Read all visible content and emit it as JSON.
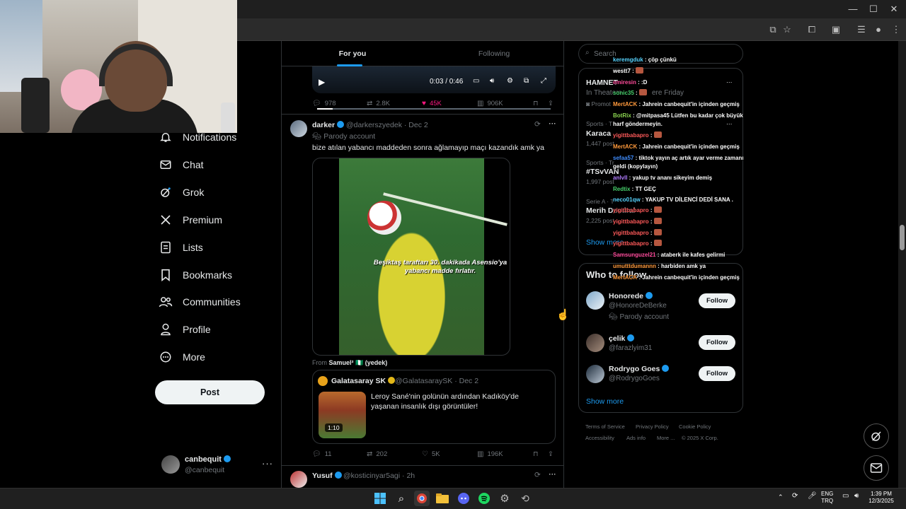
{
  "browser": {
    "controls": {
      "minimize": "—",
      "maximize": "☐",
      "close": "✕"
    }
  },
  "nav": {
    "items": [
      {
        "label": "Notifications",
        "icon": "bell-icon"
      },
      {
        "label": "Chat",
        "icon": "envelope-icon"
      },
      {
        "label": "Grok",
        "icon": "grok-icon"
      },
      {
        "label": "Premium",
        "icon": "x-logo-icon"
      },
      {
        "label": "Lists",
        "icon": "list-icon"
      },
      {
        "label": "Bookmarks",
        "icon": "bookmark-icon"
      },
      {
        "label": "Communities",
        "icon": "communities-icon"
      },
      {
        "label": "Profile",
        "icon": "person-icon"
      },
      {
        "label": "More",
        "icon": "more-circle-icon"
      }
    ],
    "post_label": "Post",
    "account": {
      "name": "canbequit",
      "handle": "@canbequit",
      "menu": "···"
    }
  },
  "timeline": {
    "tabs": [
      "For you",
      "Following"
    ],
    "video": {
      "time": "0:03 / 0:46"
    },
    "prev_actions": {
      "replies": "978",
      "reposts": "2.8K",
      "likes": "45K",
      "views": "906K"
    },
    "tweet1": {
      "name": "darker",
      "handle": "@darkerszyedek",
      "date": "· Dec 2",
      "badge": "Parody account",
      "text": "bize atılan yabancı maddeden sonra ağlamayıp maçı kazandık amk ya",
      "media_caption": "Beşiktaş taraftarı 30. dakikada Asensio'ya yabancı madde fırlatır.",
      "from_prefix": "From",
      "from_name": "Samuel² 🇳🇬 (yedek)",
      "quote": {
        "name": "Galatasaray SK",
        "handle": "@GalatasaraySK",
        "date": "· Dec 2",
        "text": "Leroy Sané'nin golünün ardından Kadıköy'de yaşanan insanlık dışı görüntüler!",
        "duration": "1:10"
      },
      "actions": {
        "replies": "11",
        "reposts": "202",
        "likes": "5K",
        "views": "196K"
      }
    },
    "tweet2": {
      "name": "Yusuf",
      "handle": "@kosticinyar5agi",
      "date": "· 2h"
    }
  },
  "sidebar": {
    "search_placeholder": "Search",
    "promo": {
      "title": "HAMNET",
      "subtitle": "In Theaters",
      "subtitle_tail": "ere Friday",
      "tag": "Promot"
    },
    "trends": [
      {
        "category": "Sports · T",
        "name": "Karaca",
        "posts": "1,447 post"
      },
      {
        "category": "Sports · Tr",
        "name": "#TSvVAN",
        "posts": "1,997 post"
      },
      {
        "category": "Serie A · T",
        "name": "Merih Demiral",
        "posts": "2,225 post"
      }
    ],
    "trends_show_more": "Show more",
    "who_to_follow": "Who to follow",
    "follow_suggestions": [
      {
        "name": "Honorede",
        "handle": "@HonoreDeBerke",
        "badge": "Parody account",
        "button": "Follow"
      },
      {
        "name": "çelik",
        "handle": "@farazlyim31",
        "button": "Follow"
      },
      {
        "name": "Rodrygo Goes",
        "handle": "@RodrygoGoes",
        "button": "Follow"
      }
    ],
    "wtf_show_more": "Show more",
    "footer": [
      "Terms of Service",
      "Privacy Policy",
      "Cookie Policy",
      "Accessibility",
      "Ads info",
      "More ...",
      "© 2025 X Corp."
    ]
  },
  "chat": [
    {
      "user": "keremgduk",
      "color": "#57d4ff",
      "msg": "çöp çünkü"
    },
    {
      "user": "westt7",
      "color": "#ffffff",
      "msg": "",
      "emote": true
    },
    {
      "user": "emiresin",
      "color": "#ff4b9b",
      "msg": ":D"
    },
    {
      "user": "sonic35",
      "color": "#47d16c",
      "msg": "",
      "emote": true
    },
    {
      "user": "MertACK",
      "color": "#ff9a3c",
      "msg": "Jahrein canbequit'in içinden geçmiş"
    },
    {
      "user": "BotRix",
      "color": "#8bd450",
      "msg": "@mitpasa45 Lütfen bu kadar çok büyük harf göndermeyin."
    },
    {
      "user": "yigittbabapro",
      "color": "#ff5a5a",
      "msg": "",
      "emote": true
    },
    {
      "user": "MertACK",
      "color": "#ff9a3c",
      "msg": "Jahrein canbequit'in içinden geçmiş"
    },
    {
      "user": "sefaa57",
      "color": "#3f8dff",
      "msg": "tiktok yayın aç artık ayar verme zamanı geldi (kopylayın)"
    },
    {
      "user": "anlvll",
      "color": "#b07cff",
      "msg": "yakup tv ananı sikeyim demiş"
    },
    {
      "user": "Redtix",
      "color": "#47d16c",
      "msg": "TT GEÇ"
    },
    {
      "user": "neco01qw",
      "color": "#57d4ff",
      "msg": "YAKUP TV DİLENCİ DEDİ SANA ."
    },
    {
      "user": "yigittbabapro",
      "color": "#ff5a5a",
      "msg": "",
      "emote": true
    },
    {
      "user": "yigittbabapro",
      "color": "#ff5a5a",
      "msg": "",
      "emote": true
    },
    {
      "user": "yigittbabapro",
      "color": "#ff5a5a",
      "msg": "",
      "emote": true
    },
    {
      "user": "yigittbabapro",
      "color": "#ff5a5a",
      "msg": "",
      "emote": true
    },
    {
      "user": "Samsunguzel21",
      "color": "#ff4b9b",
      "msg": "ataberk ile kafes gelirmi"
    },
    {
      "user": "umutttdumannn",
      "color": "#ff9a3c",
      "msg": "harbiden amk ya"
    },
    {
      "user": "MertACK",
      "color": "#ff9a3c",
      "msg": "Jahrein canbequit'in içinden geçmiş"
    }
  ],
  "taskbar": {
    "lang_top": "ENG",
    "lang_bottom": "TRQ",
    "time": "1:39 PM",
    "date": "12/3/2025"
  },
  "colors": {
    "accent": "#1d9bf0",
    "like": "#f91880",
    "background": "#000000"
  }
}
